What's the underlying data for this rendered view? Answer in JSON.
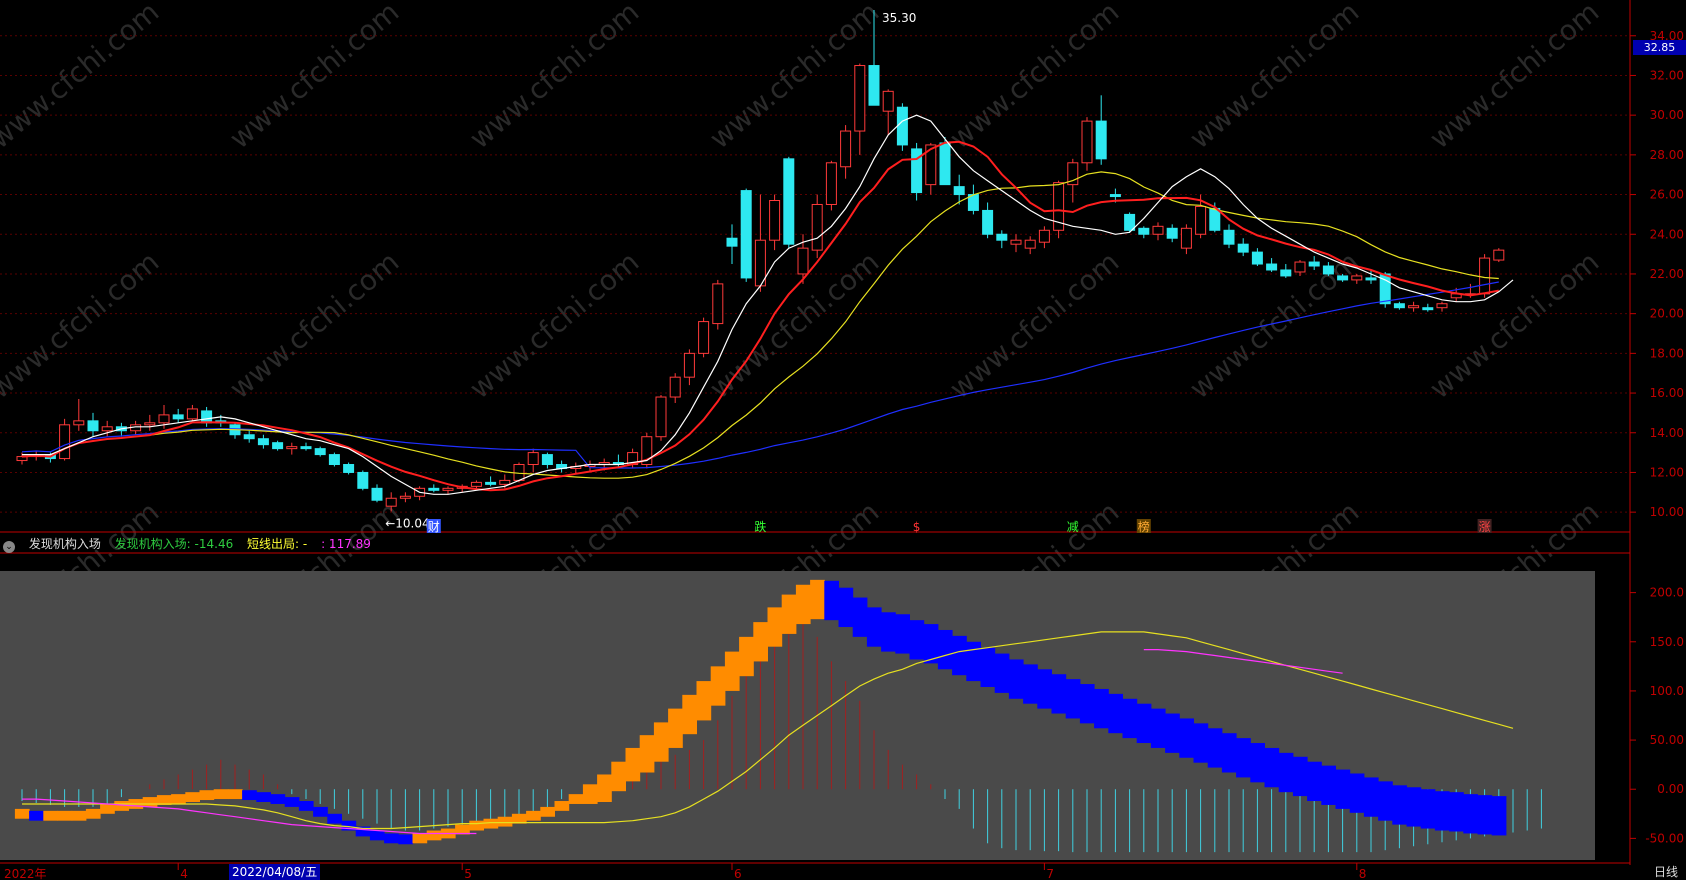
{
  "colors": {
    "up": "#ff3a3a",
    "down": "#2ee8f0",
    "ma5": "#ffffff",
    "ma10": "#ff1f1f",
    "ma20": "#e6e020",
    "ma60": "#1f2fff",
    "axis": "#c00000",
    "grid": "#5a0000",
    "watermark": "#2a2a2a",
    "panel_bg": "#4a4a4a",
    "band_up": "#ff8c00",
    "band_down": "#0000ff",
    "band_turn_up": "#00c000",
    "band_turn_down": "#ffff00",
    "hist_pos": "#a02020",
    "hist_neg": "#40d0e0"
  },
  "watermark": "www.cfchi.com",
  "price_axis": {
    "ticks": [
      "34.00",
      "32.00",
      "30.00",
      "28.00",
      "26.00",
      "24.00",
      "22.00",
      "20.00",
      "18.00",
      "16.00",
      "14.00",
      "12.00",
      "10.00"
    ]
  },
  "current_price": "32.85",
  "annotations": {
    "high": "35.30",
    "low": "←10.04"
  },
  "event_markers": [
    {
      "label": "财",
      "color": "#ffffff",
      "bg": "#3355ff"
    },
    {
      "label": "跌",
      "color": "#33ff33",
      "bg": ""
    },
    {
      "label": "$",
      "color": "#ff3333",
      "bg": ""
    },
    {
      "label": "减",
      "color": "#33ff33",
      "bg": ""
    },
    {
      "label": "榜",
      "color": "#ffaa33",
      "bg": "#664400"
    },
    {
      "label": "涨",
      "color": "#ff4444",
      "bg": "#442222"
    }
  ],
  "indicator": {
    "name": "发现机构入场",
    "value1": "发现机构入场: -14.46",
    "value2": "短线出局: -",
    "value3": ": 117.89",
    "axis_ticks": [
      "200.0",
      "150.0",
      "100.0",
      "50.00",
      "0.00",
      "-50.00"
    ]
  },
  "time_axis": {
    "labels": [
      "2022年",
      "4",
      "5",
      "6",
      "7",
      "8"
    ],
    "cursor_date": "2022/04/08/五"
  },
  "period": "日线",
  "chart_data": [
    {
      "type": "candlestick",
      "title": "",
      "ylim": [
        9.0,
        35.6
      ],
      "ohlc": [
        [
          12.6,
          13.0,
          12.4,
          12.8
        ],
        [
          12.8,
          13.1,
          12.6,
          12.9
        ],
        [
          12.9,
          13.0,
          12.5,
          12.7
        ],
        [
          12.7,
          14.7,
          12.6,
          14.4
        ],
        [
          14.4,
          15.7,
          14.1,
          14.6
        ],
        [
          14.6,
          15.0,
          13.8,
          14.1
        ],
        [
          14.1,
          14.6,
          13.8,
          14.3
        ],
        [
          14.3,
          14.5,
          13.8,
          14.1
        ],
        [
          14.1,
          14.6,
          13.9,
          14.4
        ],
        [
          14.4,
          14.9,
          14.1,
          14.5
        ],
        [
          14.5,
          15.4,
          14.2,
          14.9
        ],
        [
          14.9,
          15.2,
          14.5,
          14.7
        ],
        [
          14.7,
          15.4,
          14.6,
          15.2
        ],
        [
          15.1,
          15.3,
          14.3,
          14.5
        ],
        [
          14.6,
          14.9,
          14.3,
          14.5
        ],
        [
          14.4,
          14.5,
          13.7,
          13.9
        ],
        [
          13.9,
          14.1,
          13.5,
          13.7
        ],
        [
          13.7,
          13.9,
          13.2,
          13.4
        ],
        [
          13.5,
          13.6,
          13.1,
          13.2
        ],
        [
          13.2,
          13.5,
          12.9,
          13.3
        ],
        [
          13.3,
          13.5,
          13.1,
          13.2
        ],
        [
          13.2,
          13.3,
          12.8,
          12.9
        ],
        [
          12.9,
          13.0,
          12.3,
          12.4
        ],
        [
          12.4,
          12.5,
          11.9,
          12.0
        ],
        [
          12.0,
          12.1,
          11.1,
          11.2
        ],
        [
          11.2,
          11.4,
          10.5,
          10.6
        ],
        [
          10.3,
          11.0,
          10.04,
          10.7
        ],
        [
          10.7,
          11.0,
          10.5,
          10.8
        ],
        [
          10.8,
          11.3,
          10.6,
          11.2
        ],
        [
          11.2,
          11.4,
          11.0,
          11.1
        ],
        [
          11.1,
          11.3,
          10.9,
          11.2
        ],
        [
          11.2,
          11.4,
          11.0,
          11.3
        ],
        [
          11.3,
          11.6,
          11.1,
          11.5
        ],
        [
          11.5,
          11.8,
          11.3,
          11.4
        ],
        [
          11.4,
          11.9,
          11.2,
          11.6
        ],
        [
          11.6,
          12.5,
          11.5,
          12.4
        ],
        [
          12.4,
          13.2,
          12.0,
          13.0
        ],
        [
          12.9,
          13.0,
          12.2,
          12.4
        ],
        [
          12.4,
          12.6,
          12.0,
          12.2
        ],
        [
          12.2,
          12.5,
          11.9,
          12.3
        ],
        [
          12.3,
          12.6,
          12.0,
          12.4
        ],
        [
          12.4,
          12.7,
          12.1,
          12.5
        ],
        [
          12.5,
          12.9,
          12.2,
          12.4
        ],
        [
          12.4,
          13.2,
          12.2,
          13.0
        ],
        [
          12.4,
          14.0,
          12.2,
          13.8
        ],
        [
          13.8,
          15.9,
          13.6,
          15.8
        ],
        [
          15.8,
          17.0,
          15.5,
          16.8
        ],
        [
          16.8,
          18.2,
          16.4,
          18.0
        ],
        [
          18.0,
          19.8,
          17.8,
          19.6
        ],
        [
          19.5,
          21.7,
          19.2,
          21.5
        ],
        [
          23.8,
          24.5,
          22.5,
          23.4
        ],
        [
          26.2,
          26.3,
          21.6,
          21.8
        ],
        [
          21.4,
          26.0,
          21.1,
          23.7
        ],
        [
          23.7,
          26.0,
          23.2,
          25.7
        ],
        [
          27.8,
          27.9,
          23.3,
          23.5
        ],
        [
          22.0,
          24.0,
          21.5,
          23.3
        ],
        [
          23.2,
          26.0,
          22.8,
          25.5
        ],
        [
          25.5,
          27.7,
          25.2,
          27.6
        ],
        [
          27.4,
          29.5,
          26.8,
          29.2
        ],
        [
          29.2,
          32.6,
          28.0,
          32.5
        ],
        [
          32.5,
          35.3,
          30.5,
          30.5
        ],
        [
          30.2,
          31.3,
          29.0,
          31.2
        ],
        [
          30.4,
          30.6,
          28.2,
          28.5
        ],
        [
          28.3,
          28.6,
          25.7,
          26.1
        ],
        [
          26.5,
          28.6,
          26.0,
          28.5
        ],
        [
          28.6,
          28.9,
          26.5,
          26.5
        ],
        [
          26.4,
          27.0,
          25.5,
          26.0
        ],
        [
          26.0,
          26.5,
          25.0,
          25.2
        ],
        [
          25.2,
          25.6,
          23.8,
          24.0
        ],
        [
          24.0,
          24.2,
          23.3,
          23.7
        ],
        [
          23.5,
          24.0,
          23.1,
          23.7
        ],
        [
          23.3,
          23.9,
          23.0,
          23.7
        ],
        [
          23.6,
          24.4,
          23.3,
          24.2
        ],
        [
          24.2,
          26.7,
          23.8,
          26.6
        ],
        [
          26.5,
          27.8,
          25.6,
          27.6
        ],
        [
          27.6,
          29.9,
          27.2,
          29.7
        ],
        [
          29.7,
          31.0,
          27.5,
          27.8
        ],
        [
          26.0,
          26.3,
          25.6,
          25.9
        ],
        [
          25.0,
          25.1,
          24.1,
          24.2
        ],
        [
          24.3,
          24.4,
          23.8,
          24.0
        ],
        [
          24.0,
          24.6,
          23.7,
          24.4
        ],
        [
          24.3,
          24.5,
          23.6,
          23.8
        ],
        [
          23.3,
          24.5,
          23.0,
          24.3
        ],
        [
          24.0,
          26.0,
          23.8,
          25.4
        ],
        [
          25.3,
          25.6,
          24.1,
          24.2
        ],
        [
          24.2,
          24.5,
          23.3,
          23.5
        ],
        [
          23.5,
          23.8,
          22.9,
          23.1
        ],
        [
          23.1,
          23.3,
          22.4,
          22.5
        ],
        [
          22.5,
          22.8,
          22.1,
          22.2
        ],
        [
          22.2,
          22.5,
          21.8,
          21.9
        ],
        [
          22.1,
          22.7,
          21.9,
          22.6
        ],
        [
          22.6,
          22.9,
          22.2,
          22.4
        ],
        [
          22.4,
          22.6,
          21.9,
          22.0
        ],
        [
          21.9,
          22.0,
          21.6,
          21.7
        ],
        [
          21.7,
          22.0,
          21.5,
          21.9
        ],
        [
          21.8,
          22.2,
          21.5,
          21.7
        ],
        [
          22.0,
          22.1,
          20.3,
          20.5
        ],
        [
          20.5,
          20.6,
          20.2,
          20.3
        ],
        [
          20.3,
          20.6,
          20.1,
          20.4
        ],
        [
          20.3,
          20.5,
          20.1,
          20.2
        ],
        [
          20.3,
          20.6,
          20.1,
          20.5
        ],
        [
          20.8,
          21.3,
          20.6,
          21.0
        ],
        [
          21.0,
          21.5,
          20.8,
          21.0
        ],
        [
          21.0,
          23.0,
          20.8,
          22.8
        ],
        [
          22.7,
          23.3,
          22.6,
          23.2
        ]
      ],
      "ma5": [
        12.9,
        12.9,
        12.9,
        13.2,
        13.5,
        13.8,
        14.0,
        14.2,
        14.3,
        14.3,
        14.4,
        14.5,
        14.6,
        14.7,
        14.8,
        14.7,
        14.5,
        14.3,
        14.1,
        13.9,
        13.7,
        13.6,
        13.4,
        13.2,
        12.8,
        12.3,
        11.8,
        11.4,
        11.0,
        10.9,
        10.9,
        11.0,
        11.1,
        11.2,
        11.3,
        11.6,
        11.9,
        12.1,
        12.2,
        12.3,
        12.4,
        12.4,
        12.4,
        12.5,
        12.6,
        13.1,
        13.9,
        15.0,
        16.3,
        17.6,
        19.2,
        20.5,
        21.4,
        22.6,
        23.3,
        23.6,
        23.8,
        24.4,
        25.3,
        26.4,
        27.8,
        29.0,
        29.7,
        30.0,
        29.7,
        28.8,
        27.9,
        27.2,
        26.7,
        26.2,
        25.7,
        25.2,
        24.8,
        24.6,
        24.4,
        24.3,
        24.2,
        24.0,
        24.1,
        24.8,
        25.6,
        26.4,
        26.9,
        27.3,
        26.9,
        26.3,
        25.5,
        24.8,
        24.3,
        23.9,
        23.5,
        23.1,
        22.8,
        22.5,
        22.3,
        22.0,
        21.7,
        21.3,
        21.1,
        20.9,
        20.7,
        20.6,
        20.6,
        20.7,
        21.1,
        21.7
      ]
    },
    {
      "type": "band",
      "title": "发现机构入场",
      "ylim": [
        -72,
        222
      ],
      "histogram": [
        -12,
        -14,
        -16,
        -18,
        -18,
        -18,
        -18,
        -8,
        0,
        5,
        10,
        15,
        20,
        25,
        30,
        25,
        20,
        15,
        5,
        -5,
        -10,
        -15,
        -20,
        -25,
        -30,
        -35,
        -40,
        -42,
        -42,
        -40,
        -38,
        -36,
        -34,
        -32,
        -30,
        -28,
        -26,
        -20,
        -10,
        0,
        5,
        10,
        15,
        20,
        25,
        30,
        35,
        40,
        50,
        70,
        95,
        120,
        150,
        175,
        185,
        170,
        155,
        130,
        110,
        90,
        60,
        40,
        25,
        15,
        5,
        -10,
        -20,
        -40,
        -55,
        -60,
        -62,
        -62,
        -63,
        -63,
        -64,
        -64,
        -64,
        -64,
        -64,
        -64,
        -64,
        -64,
        -64,
        -64,
        -64,
        -64,
        -64,
        -64,
        -64,
        -64,
        -64,
        -64,
        -64,
        -64,
        -64,
        -64,
        -62,
        -60,
        -58,
        -56,
        -54,
        -52,
        -50,
        -48,
        -46,
        -44,
        -42,
        -40
      ],
      "band_upper": [
        -20,
        -22,
        -22,
        -22,
        -22,
        -20,
        -15,
        -12,
        -10,
        -8,
        -6,
        -5,
        -3,
        -1,
        0,
        0,
        -1,
        -3,
        -5,
        -8,
        -12,
        -18,
        -25,
        -32,
        -38,
        -42,
        -45,
        -46,
        -45,
        -42,
        -40,
        -36,
        -32,
        -30,
        -28,
        -25,
        -22,
        -18,
        -12,
        -5,
        5,
        15,
        28,
        42,
        55,
        68,
        82,
        96,
        110,
        125,
        140,
        155,
        170,
        185,
        198,
        208,
        213,
        212,
        205,
        195,
        185,
        180,
        178,
        172,
        168,
        162,
        156,
        150,
        144,
        138,
        132,
        127,
        122,
        117,
        112,
        107,
        102,
        97,
        92,
        87,
        82,
        77,
        72,
        67,
        62,
        57,
        52,
        47,
        42,
        37,
        33,
        28,
        24,
        20,
        16,
        12,
        8,
        4,
        2,
        0,
        -2,
        -3,
        -5,
        -6,
        -7,
        -7
      ],
      "band_width": [
        10,
        10,
        10,
        10,
        10,
        10,
        10,
        10,
        10,
        10,
        10,
        10,
        10,
        10,
        10,
        10,
        10,
        10,
        10,
        10,
        10,
        10,
        10,
        10,
        10,
        10,
        10,
        10,
        10,
        10,
        10,
        10,
        10,
        10,
        10,
        10,
        10,
        10,
        10,
        10,
        20,
        28,
        30,
        34,
        38,
        40,
        40,
        40,
        40,
        40,
        40,
        40,
        40,
        40,
        40,
        40,
        40,
        40,
        40,
        40,
        40,
        40,
        40,
        40,
        40,
        40,
        40,
        40,
        40,
        40,
        40,
        40,
        40,
        40,
        40,
        40,
        40,
        40,
        40,
        40,
        40,
        40,
        40,
        40,
        40,
        40,
        40,
        40,
        40,
        40,
        40,
        40,
        40,
        40,
        40,
        40,
        40,
        40,
        40,
        40,
        40,
        40,
        40,
        40,
        40,
        40
      ],
      "line_yellow": [
        -15,
        -15,
        -15,
        -15,
        -15,
        -15,
        -15,
        -15,
        -15,
        -15,
        -15,
        -15,
        -15,
        -15,
        -16,
        -17,
        -19,
        -21,
        -24,
        -28,
        -32,
        -35,
        -37,
        -38,
        -40,
        -40,
        -40,
        -39,
        -38,
        -37,
        -36,
        -35,
        -35,
        -34,
        -34,
        -34,
        -34,
        -34,
        -34,
        -34,
        -34,
        -34,
        -33,
        -32,
        -30,
        -28,
        -24,
        -18,
        -10,
        -2,
        8,
        18,
        30,
        42,
        55,
        65,
        75,
        85,
        95,
        105,
        112,
        118,
        122,
        128,
        132,
        136,
        140,
        142,
        144,
        146,
        148,
        150,
        152,
        154,
        156,
        158,
        160,
        160,
        160,
        160,
        158,
        156,
        154,
        150,
        146,
        142,
        138,
        134,
        130,
        126,
        122,
        118,
        114,
        110,
        106,
        102,
        98,
        94,
        90,
        86,
        82,
        78,
        74,
        70,
        66,
        62
      ],
      "line_magenta": [
        -10,
        -10,
        -11,
        -12,
        -13,
        -14,
        -15,
        -16,
        -17,
        -18,
        -19,
        -20,
        -22,
        -24,
        -26,
        -28,
        -30,
        -32,
        -34,
        -36,
        -37,
        -38,
        -39,
        -40,
        -41,
        -42,
        -43,
        -44,
        -45,
        -45,
        -45,
        -45,
        -45,
        null,
        null,
        null,
        null,
        null,
        null,
        null,
        null,
        null,
        null,
        null,
        null,
        null,
        null,
        null,
        null,
        null,
        null,
        null,
        null,
        null,
        null,
        null,
        null,
        null,
        null,
        null,
        null,
        null,
        null,
        null,
        null,
        null,
        null,
        null,
        null,
        null,
        null,
        null,
        null,
        null,
        null,
        null,
        null,
        null,
        null,
        142,
        142,
        141,
        140,
        138,
        136,
        134,
        132,
        130,
        128,
        126,
        124,
        122,
        120,
        118
      ]
    }
  ]
}
